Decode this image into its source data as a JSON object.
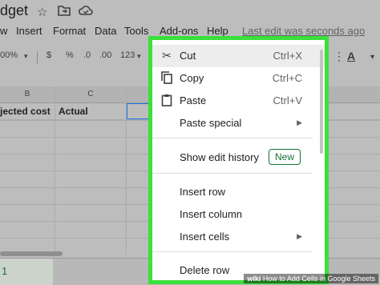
{
  "app": {
    "doc_title": "dget",
    "last_edit": "Last edit was seconds ago"
  },
  "menu": [
    "w",
    "Insert",
    "Format",
    "Data",
    "Tools",
    "Add-ons",
    "Help"
  ],
  "toolbar": {
    "zoom": "00%",
    "currency": "$",
    "percent": "%",
    "dec_decrease": ".0",
    "dec_increase": ".00",
    "number_format": "123"
  },
  "grid": {
    "columns": [
      "B",
      "C"
    ],
    "row1": [
      "jected cost",
      "Actual"
    ]
  },
  "sheet_tab": "1",
  "context_menu": {
    "cut": {
      "label": "Cut",
      "shortcut": "Ctrl+X"
    },
    "copy": {
      "label": "Copy",
      "shortcut": "Ctrl+C"
    },
    "paste": {
      "label": "Paste",
      "shortcut": "Ctrl+V"
    },
    "paste_special": {
      "label": "Paste special"
    },
    "show_edit_history": {
      "label": "Show edit history",
      "badge": "New"
    },
    "insert_row": {
      "label": "Insert row"
    },
    "insert_column": {
      "label": "Insert column"
    },
    "insert_cells": {
      "label": "Insert cells"
    },
    "delete_row": {
      "label": "Delete row"
    }
  },
  "icons": {
    "star": "star-icon",
    "folder": "move-folder-icon",
    "cloud": "cloud-status-icon",
    "cut": "scissors-icon",
    "copy": "copy-icon",
    "paste": "clipboard-icon",
    "submenu": "submenu-arrow-icon"
  },
  "colors": {
    "highlight_border": "#3be03b",
    "new_badge": "#137333",
    "selection": "#1a73e8"
  },
  "watermark": {
    "prefix": "wiki",
    "text": "How to Add Cells in Google Sheets"
  }
}
